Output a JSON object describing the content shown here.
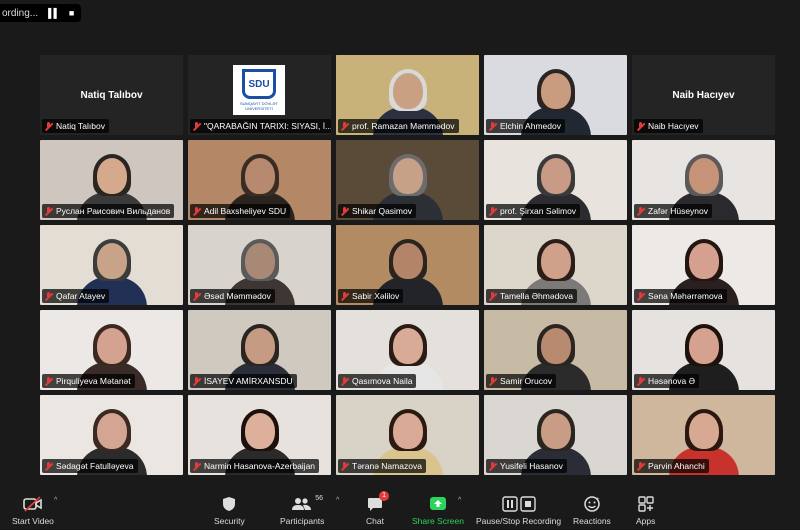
{
  "recording": {
    "text": "ording...",
    "pause_icon": "pause-icon",
    "stop_icon": "stop-icon"
  },
  "participants_tiles": [
    {
      "name": "Natiq Talıbov",
      "type": "name",
      "center": "Natiq Talıbov"
    },
    {
      "name": "\"QARABAĞIN TARIXI: SIYASI, İ...",
      "type": "logo"
    },
    {
      "name": "prof. Ramazan Məmmədov",
      "type": "video",
      "active": true,
      "bg": "#c9b27a",
      "skin": "#caa082",
      "shirt": "#2c3040",
      "hair": "#d9d9d9"
    },
    {
      "name": "Elchin Ahmedov",
      "type": "video",
      "bg": "#d9dbe0",
      "skin": "#c99b7f",
      "shirt": "#222831",
      "hair": "#2a2522"
    },
    {
      "name": "Naib Hacıyev",
      "type": "name",
      "center": "Naib Hacıyev"
    },
    {
      "name": "Руслан Раисович  Вильданов",
      "type": "video",
      "bg": "#cfc7bf",
      "skin": "#d4a98c",
      "shirt": "#3a3a3a",
      "hair": "#2a2520"
    },
    {
      "name": "Adil Baxsheliyev SDU",
      "type": "video",
      "bg": "#b48766",
      "skin": "#b78a70",
      "shirt": "#2a241f",
      "hair": "#3a2c24"
    },
    {
      "name": "Shikar Qasimov",
      "type": "video",
      "bg": "#5a4a38",
      "skin": "#c7a088",
      "shirt": "#2d2f36",
      "hair": "#6c6c6c"
    },
    {
      "name": "prof. Şirxan Səlimov",
      "type": "video",
      "bg": "#e9e3dd",
      "skin": "#c99a85",
      "shirt": "#2b2b30",
      "hair": "#3a3a3a"
    },
    {
      "name": "Zafər Hüseynov",
      "type": "video",
      "bg": "#e7e4e2",
      "skin": "#c69378",
      "shirt": "#2a2a2e",
      "hair": "#5a5a5a"
    },
    {
      "name": "Qafar Atayev",
      "type": "video",
      "bg": "#e3ddd3",
      "skin": "#c8a38a",
      "shirt": "#233056",
      "hair": "#3c3c3c"
    },
    {
      "name": "Əsəd Məmmədov",
      "type": "video",
      "bg": "#d8d3cd",
      "skin": "#a88975",
      "shirt": "#3e3632",
      "hair": "#5a5a5a"
    },
    {
      "name": "Sabir Xəlilov",
      "type": "video",
      "bg": "#b38b63",
      "skin": "#b48468",
      "shirt": "#22242a",
      "hair": "#2a2420"
    },
    {
      "name": "Tamella Əhmədova",
      "type": "video",
      "bg": "#ddd6cb",
      "skin": "#cfa18b",
      "shirt": "#7c7a78",
      "hair": "#2b1d17"
    },
    {
      "name": "Səna Məhərrəmova",
      "type": "video",
      "bg": "#ede9e6",
      "skin": "#d5a08f",
      "shirt": "#2a2020",
      "hair": "#24160f"
    },
    {
      "name": "Pirquliyeva Mətanət",
      "type": "video",
      "bg": "#ece8e5",
      "skin": "#d3a290",
      "shirt": "#3a2a28",
      "hair": "#3b2920"
    },
    {
      "name": "İSAYEV AMİRXANSDU",
      "type": "video",
      "bg": "#d0c9c0",
      "skin": "#c59b83",
      "shirt": "#2b2f3a",
      "hair": "#2a2520"
    },
    {
      "name": "Qasımova Naila",
      "type": "video",
      "bg": "#e4e0db",
      "skin": "#d7ab95",
      "shirt": "#e6e6e6",
      "hair": "#2a1b14"
    },
    {
      "name": "Samir Orucov",
      "type": "video",
      "bg": "#c8bba6",
      "skin": "#b88a70",
      "shirt": "#2b2b2b",
      "hair": "#2a2520"
    },
    {
      "name": "Həsənova Ə",
      "type": "video",
      "bg": "#e6e2df",
      "skin": "#d4a28f",
      "shirt": "#1e1e1e",
      "hair": "#1d120c"
    },
    {
      "name": "Sədagət Fatulləyeva",
      "type": "video",
      "bg": "#ebe6e2",
      "skin": "#d3a592",
      "shirt": "#2b2b2b",
      "hair": "#3a2a20"
    },
    {
      "name": "Narmin Hasanova-Azerbaijan",
      "type": "video",
      "bg": "#e7e2dd",
      "skin": "#dcb09b",
      "shirt": "#2a2a2a",
      "hair": "#1b100b"
    },
    {
      "name": "Təranə Namazova",
      "type": "video",
      "bg": "#d8d2c7",
      "skin": "#d9ab96",
      "shirt": "#d8c48c",
      "hair": "#2a1a10"
    },
    {
      "name": "Yusifeli Hasanov",
      "type": "video",
      "bg": "#dad6d1",
      "skin": "#c89c85",
      "shirt": "#2a2d36",
      "hair": "#2a2520"
    },
    {
      "name": "Parvin Ahanchi",
      "type": "video",
      "bg": "#cfb79e",
      "skin": "#d7a892",
      "shirt": "#c8322d",
      "hair": "#2a1810"
    }
  ],
  "logo": {
    "mark": "SDU",
    "line1": "SUMQAYIT DÖVLƏT",
    "line2": "UNİVERSİTETİ"
  },
  "toolbar": {
    "start_video": "Start Video",
    "security": "Security",
    "participants": "Participants",
    "participants_count": "56",
    "chat": "Chat",
    "chat_badge": "1",
    "share_screen": "Share Screen",
    "record": "Pause/Stop Recording",
    "reactions": "Reactions",
    "apps": "Apps"
  },
  "colors": {
    "active_speaker": "#c7d33a",
    "share_green": "#2bd45a",
    "mute_red": "#e23b3b"
  }
}
